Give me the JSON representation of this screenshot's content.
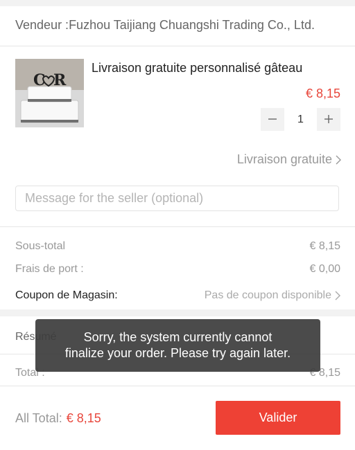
{
  "seller": {
    "label": "Vendeur :Fuzhou Taijiang Chuangshi Trading Co., Ltd."
  },
  "product": {
    "title": "Livraison gratuite personnalisé gâteau",
    "price": "€ 8,15",
    "quantity": "1",
    "image_icon": "cake-topper-product-image"
  },
  "shipping": {
    "label": "Livraison gratuite",
    "icon": "chevron-right-icon"
  },
  "message": {
    "placeholder": "Message for the seller (optional)",
    "value": ""
  },
  "costs": {
    "subtotal_label": "Sous-total",
    "subtotal_value": "€ 8,15",
    "shipping_label": "Frais de port :",
    "shipping_value": "€ 0,00",
    "coupon_label": "Coupon de Magasin:",
    "coupon_value": "Pas de coupon disponible"
  },
  "summary": {
    "title": "Résumé",
    "total_label": "Total :",
    "total_value": "€ 8,15"
  },
  "toast": {
    "line1": "Sorry, the system currently cannot",
    "line2": "finalize your order. Please try again later."
  },
  "footer": {
    "all_total_label": "All Total:",
    "all_total_value": "€ 8,15",
    "validate_label": "Valider"
  },
  "colors": {
    "accent": "#ee4135",
    "price": "#e8463b",
    "toast_bg": "#3c3c3c"
  }
}
